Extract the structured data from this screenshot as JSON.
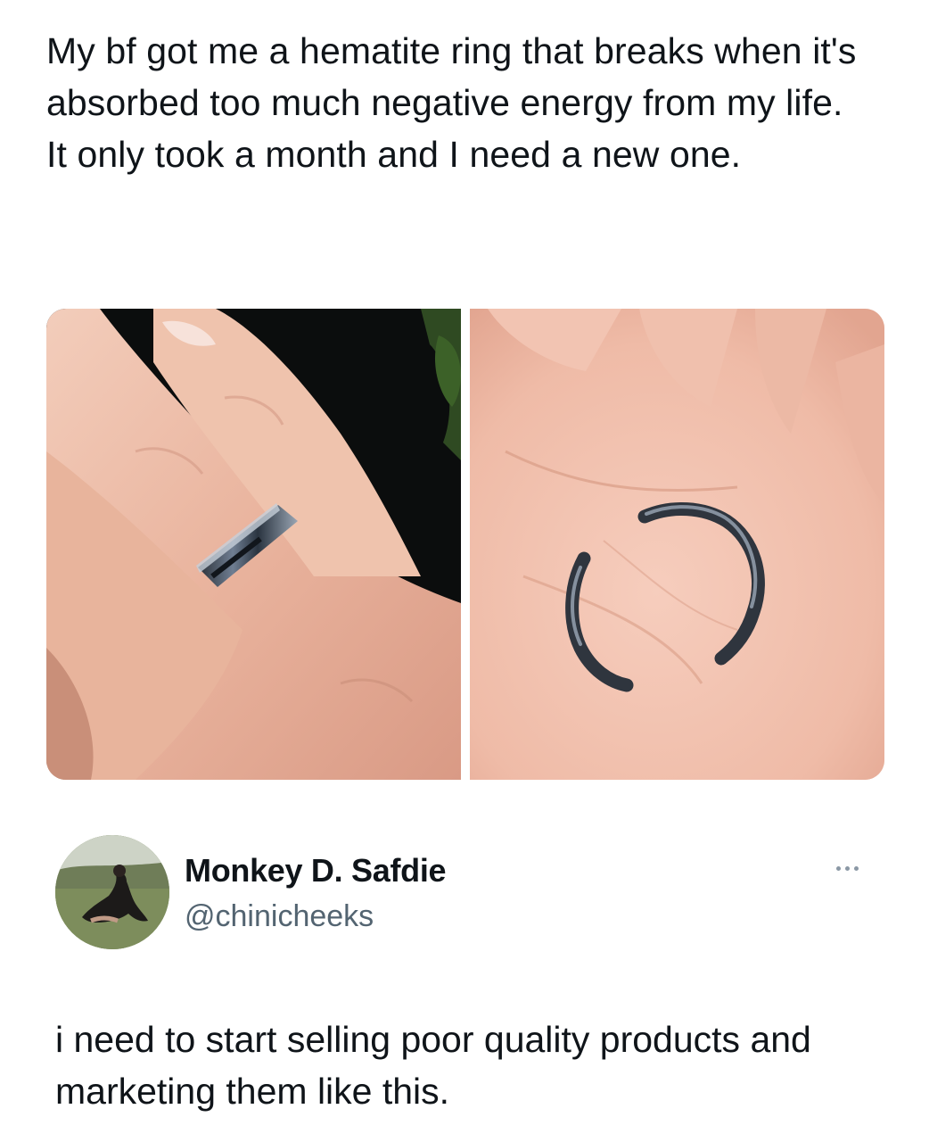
{
  "quoted_post": {
    "text": "My bf got me a hematite ring that breaks when it's absorbed too much negative energy from my life. It only took a month and I need a new one."
  },
  "media": [
    {
      "icon": "intact-ring-on-finger-photo"
    },
    {
      "icon": "broken-ring-in-palm-photo"
    }
  ],
  "post": {
    "author": {
      "display_name": "Monkey D. Safdie",
      "handle": "@chinicheeks",
      "avatar_icon": "avatar-photo"
    },
    "more_icon": "more-options-icon",
    "text": "i need to start selling poor quality products and marketing them like this."
  },
  "colors": {
    "text_primary": "#0f1419",
    "text_secondary": "#536471",
    "background": "#ffffff"
  }
}
